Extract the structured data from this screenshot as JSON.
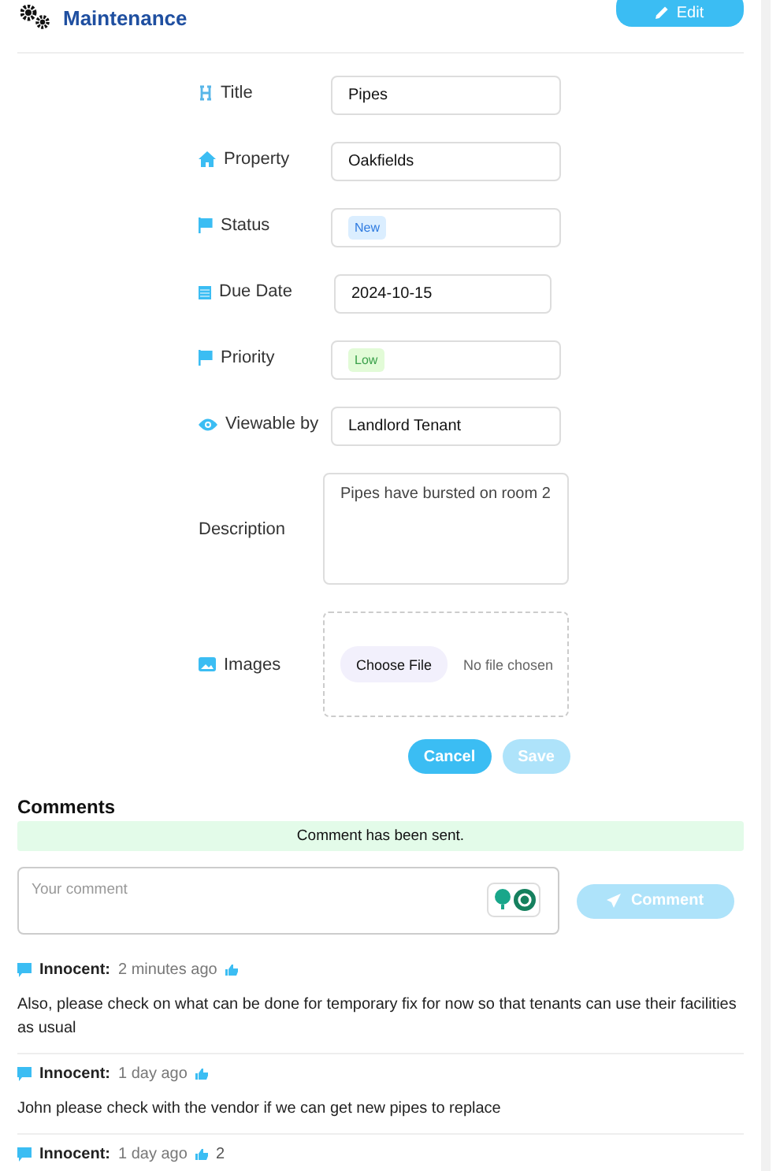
{
  "header": {
    "title": "Maintenance",
    "edit_button": "Edit"
  },
  "fields": [
    {
      "kind": "text",
      "label": "Title",
      "value": "Pipes"
    },
    {
      "kind": "text",
      "label": "Property",
      "value": "Oakfields"
    },
    {
      "kind": "badge",
      "label": "Status",
      "value": "New",
      "color": "#dbeeff"
    },
    {
      "kind": "date",
      "label": "Due Date",
      "value": "2024-10-15"
    },
    {
      "kind": "badge",
      "label": "Priority",
      "value": "Low",
      "color": "#e2fbd7"
    },
    {
      "kind": "text",
      "label": "Viewable by",
      "value": "Landlord Tenant"
    },
    {
      "kind": "textarea",
      "label": "Description",
      "value": "Pipes have bursted on room 2"
    },
    {
      "kind": "file",
      "label": "Images",
      "button": "Choose File",
      "status": "No file chosen"
    }
  ],
  "actions": [
    {
      "label": "Cancel",
      "disabled": false
    },
    {
      "label": "Save",
      "disabled": true
    }
  ],
  "comments_section": {
    "title": "Comments",
    "alert": "Comment has been sent.",
    "placeholder": "Your comment",
    "submit": {
      "label": "Comment",
      "disabled": true
    }
  },
  "comments": [
    {
      "author": "Innocent:",
      "time": "2 minutes ago",
      "body": "Also, please check on what can be done for temporary fix for now so that tenants can use their facilities as usual"
    },
    {
      "author": "Innocent:",
      "time": "1 day ago",
      "body": "John please check with the vendor if we can get new pipes to replace"
    },
    {
      "author": "Innocent:",
      "time": "1 day ago",
      "likes": "2"
    }
  ]
}
